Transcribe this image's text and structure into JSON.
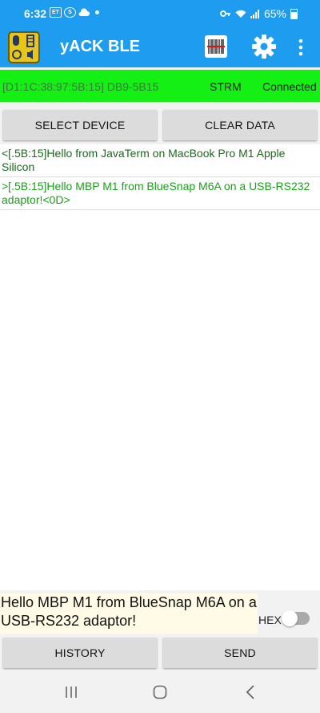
{
  "status_bar": {
    "time": "6:32",
    "notification_icons": [
      "ET-icon",
      "S-icon",
      "cloud-icon"
    ],
    "battery": "65%"
  },
  "app_bar": {
    "title": "yACK BLE"
  },
  "connection": {
    "address": "[D1:1C:38:97:5B:15] DB9-5B15",
    "mode": "STRM",
    "state": "Connected",
    "color": "#14f014"
  },
  "buttons": {
    "select_device": "SELECT DEVICE",
    "clear_data": "CLEAR DATA",
    "history": "HISTORY",
    "send": "SEND"
  },
  "log": {
    "lines": [
      "<[.5B:15]Hello from JavaTerm on MacBook Pro M1 Apple Silicon",
      ">[.5B:15]Hello MBP M1 from BlueSnap M6A on a USB-RS232 adaptor!<0D>"
    ]
  },
  "composer": {
    "text": "Hello MBP M1 from BlueSnap M6A on a USB-RS232 adaptor!",
    "hex_label": "HEX",
    "hex_enabled": false
  },
  "colors": {
    "accent": "#1e9cf0",
    "rx_text": "#1a6a1a",
    "tx_text": "#1aa01a"
  }
}
